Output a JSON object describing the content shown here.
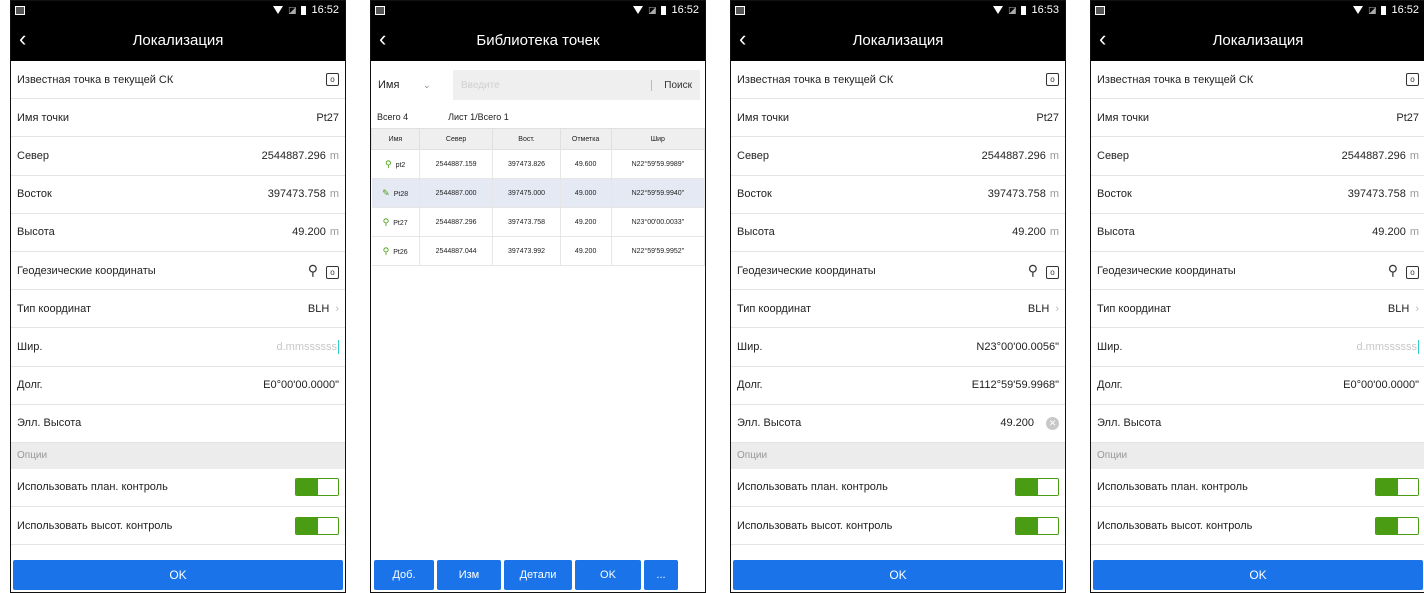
{
  "status_time_a": "16:52",
  "status_time_b": "16:53",
  "loc": {
    "title": "Локализация",
    "known_point_label": "Известная точка в текущей СК",
    "point_name_label": "Имя точки",
    "point_name": "Pt27",
    "north_label": "Север",
    "north_value": "2544887.296",
    "east_label": "Восток",
    "east_value": "397473.758",
    "height_label": "Высота",
    "height_value": "49.200",
    "unit": "m",
    "geo_label": "Геодезические координаты",
    "coord_type_label": "Тип координат",
    "coord_type_value": "BLH",
    "lat_label": "Шир.",
    "lat_placeholder": "d.mmssssss",
    "lon_label": "Долг.",
    "lon_value": "E0°00'00.0000\"",
    "ell_label": "Элл. Высота",
    "options_label": "Опции",
    "use_plan_label": "Использовать план. контроль",
    "use_height_label": "Использовать высот. контроль",
    "ok_label": "OK"
  },
  "loc3": {
    "lat_value": "N23°00'00.0056\"",
    "lon_value": "E112°59'59.9968\"",
    "ell_value": "49.200"
  },
  "lib": {
    "title": "Библиотека точек",
    "field_label": "Имя",
    "search_placeholder": "Введите",
    "search_button": "Поиск",
    "total": "Всего 4",
    "page": "Лист 1/Всего 1",
    "columns": [
      "Имя",
      "Север",
      "Вост.",
      "Отметка",
      "Шир"
    ],
    "rows": [
      {
        "name": "pt2",
        "north": "2544887.159",
        "east": "397473.826",
        "elev": "49.600",
        "lat": "N22°59'59.9989\"",
        "icon": "survey-point-icon"
      },
      {
        "name": "Pt28",
        "north": "2544887.000",
        "east": "397475.000",
        "elev": "49.000",
        "lat": "N22°59'59.9940\"",
        "icon": "pencil-icon"
      },
      {
        "name": "Pt27",
        "north": "2544887.296",
        "east": "397473.758",
        "elev": "49.200",
        "lat": "N23°00'00.0033\"",
        "icon": "survey-point-icon"
      },
      {
        "name": "Pt26",
        "north": "2544887.044",
        "east": "397473.992",
        "elev": "49.200",
        "lat": "N22°59'59.9952\"",
        "icon": "survey-point-icon"
      }
    ],
    "buttons": {
      "add": "Доб.",
      "edit": "Изм",
      "details": "Детали",
      "ok": "OK",
      "more": "..."
    }
  },
  "colors": {
    "accent": "#1a73e8",
    "toggle_on": "#4a9c13",
    "selected_row": "#e4e9f4"
  }
}
